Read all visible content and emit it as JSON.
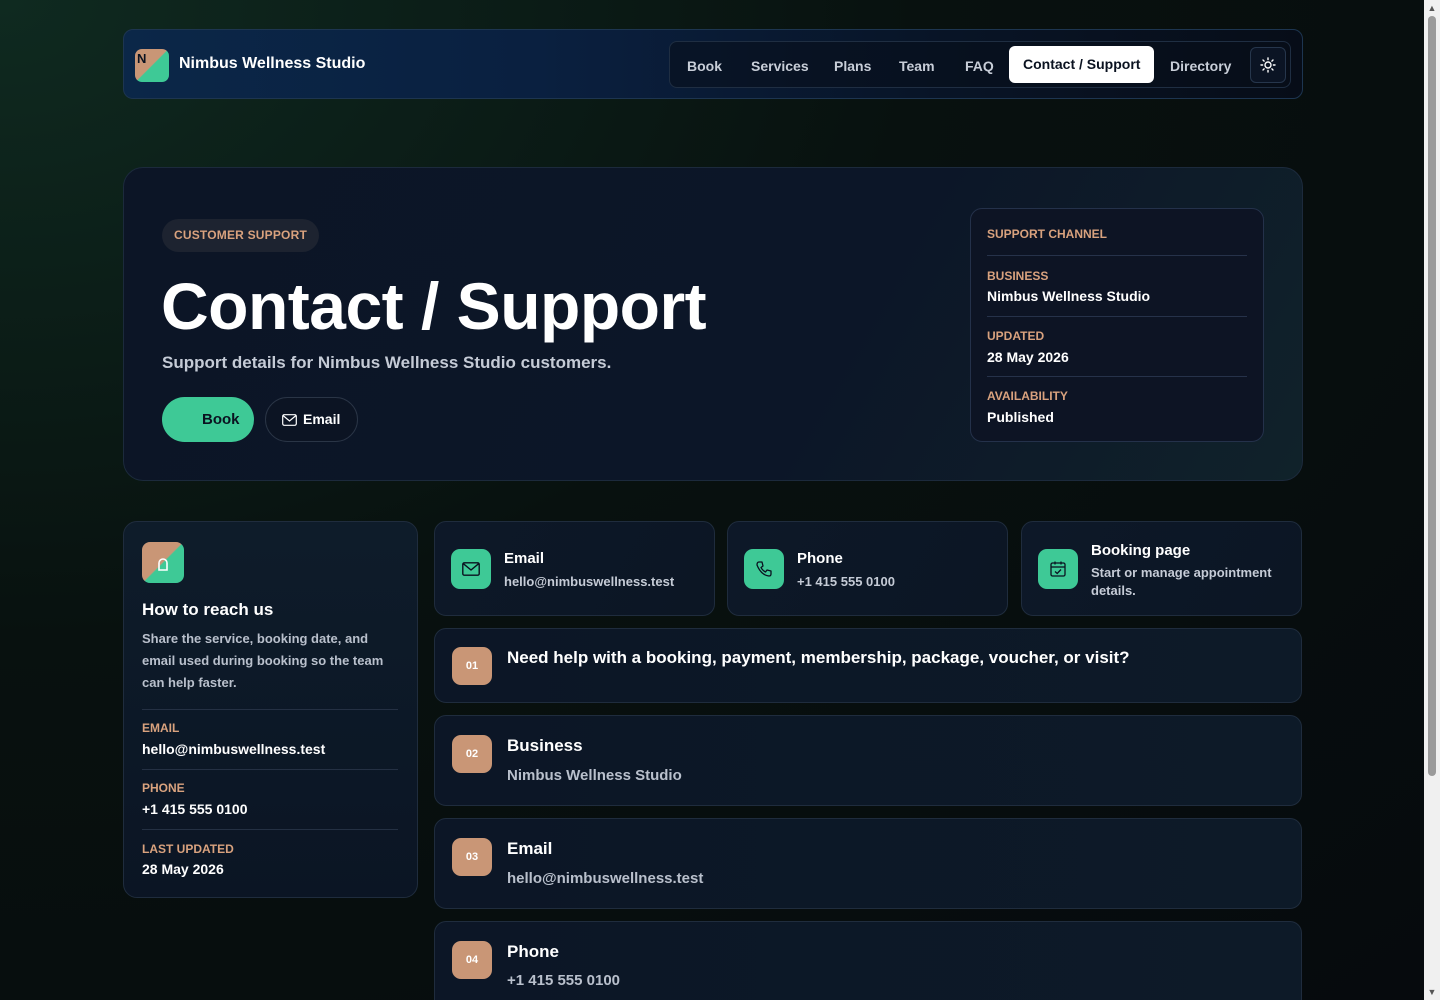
{
  "header": {
    "logo_letter": "N",
    "brand_name": "Nimbus Wellness Studio",
    "nav": [
      {
        "label": "Book"
      },
      {
        "label": "Services"
      },
      {
        "label": "Plans"
      },
      {
        "label": "Team"
      },
      {
        "label": "FAQ"
      },
      {
        "label": "Contact / Support",
        "active": true
      },
      {
        "label": "Directory"
      }
    ],
    "theme_icon": "sun-icon"
  },
  "hero": {
    "pill": "CUSTOMER SUPPORT",
    "title": "Contact / Support",
    "subtitle": "Support details for Nimbus Wellness Studio customers.",
    "book_label": "Book",
    "email_label": "Email",
    "channel": {
      "heading": "SUPPORT CHANNEL",
      "fields": [
        {
          "label": "BUSINESS",
          "value": "Nimbus Wellness Studio"
        },
        {
          "label": "UPDATED",
          "value": "28 May 2026"
        },
        {
          "label": "AVAILABILITY",
          "value": "Published"
        }
      ]
    }
  },
  "reach": {
    "title": "How to reach us",
    "description": "Share the service, booking date, and email used during booking so the team can help faster.",
    "fields": [
      {
        "label": "EMAIL",
        "value": "hello@nimbuswellness.test"
      },
      {
        "label": "PHONE",
        "value": "+1 415 555 0100"
      },
      {
        "label": "LAST UPDATED",
        "value": "28 May 2026"
      }
    ]
  },
  "methods": [
    {
      "icon": "mail-icon",
      "title": "Email",
      "value": "hello@nimbuswellness.test"
    },
    {
      "icon": "phone-icon",
      "title": "Phone",
      "value": "+1 415 555 0100"
    },
    {
      "icon": "calendar-icon",
      "title": "Booking page",
      "value": "Start or manage appointment details."
    }
  ],
  "rows": [
    {
      "num": "01",
      "title": "Need help with a booking, payment, membership, package, voucher, or visit?",
      "value": ""
    },
    {
      "num": "02",
      "title": "Business",
      "value": "Nimbus Wellness Studio"
    },
    {
      "num": "03",
      "title": "Email",
      "value": "hello@nimbuswellness.test"
    },
    {
      "num": "04",
      "title": "Phone",
      "value": "+1 415 555 0100"
    }
  ],
  "colors": {
    "accent_green": "#3ec996",
    "accent_tan": "#c99676",
    "label_tan": "#d9a27e",
    "background": "#08110f"
  }
}
